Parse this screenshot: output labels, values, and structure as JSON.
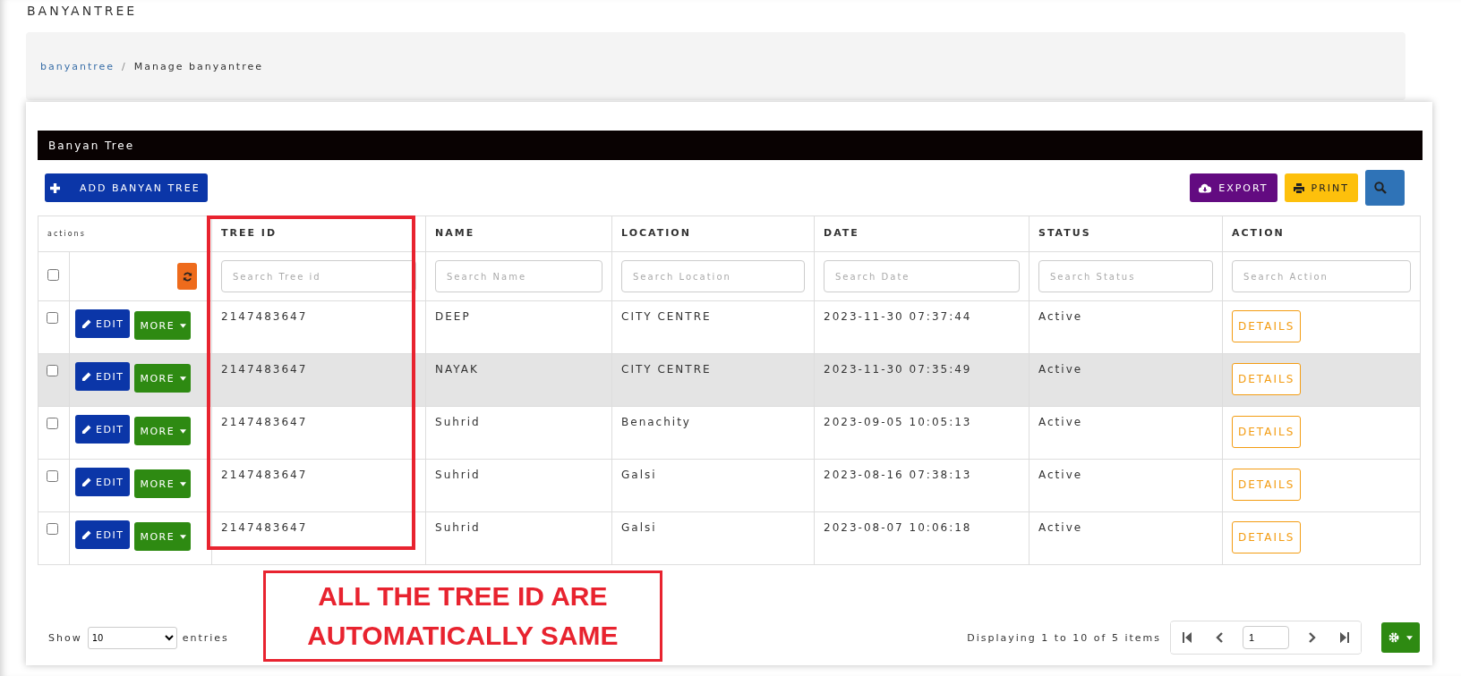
{
  "page_title": "BANYANTREE",
  "breadcrumb": {
    "link": "banyantree",
    "separator": "/",
    "current": "Manage banyantree"
  },
  "panel": {
    "title": "Banyan Tree",
    "add_button": "ADD BANYAN TREE",
    "export_button": "EXPORT",
    "print_button": "PRINT"
  },
  "table": {
    "actions_header": "actions",
    "columns": [
      "TREE ID",
      "NAME",
      "LOCATION",
      "DATE",
      "STATUS",
      "ACTION"
    ],
    "filters": [
      {
        "placeholder": "Search Tree id"
      },
      {
        "placeholder": "Search Name"
      },
      {
        "placeholder": "Search Location"
      },
      {
        "placeholder": "Search Date"
      },
      {
        "placeholder": "Search Status"
      },
      {
        "placeholder": "Search Action"
      }
    ],
    "select_all": {
      "checked": false
    },
    "rows": [
      {
        "checked": false,
        "hovered": false,
        "edit": "EDIT",
        "more": "MORE",
        "tree_id": "2147483647",
        "name": "DEEP",
        "location": "CITY CENTRE",
        "date": "2023-11-30 07:37:44",
        "status": "Active",
        "action": "DETAILS"
      },
      {
        "checked": false,
        "hovered": true,
        "edit": "EDIT",
        "more": "MORE",
        "tree_id": "2147483647",
        "name": "NAYAK",
        "location": "CITY CENTRE",
        "date": "2023-11-30 07:35:49",
        "status": "Active",
        "action": "DETAILS"
      },
      {
        "checked": false,
        "hovered": false,
        "edit": "EDIT",
        "more": "MORE",
        "tree_id": "2147483647",
        "name": "Suhrid",
        "location": "Benachity",
        "date": "2023-09-05 10:05:13",
        "status": "Active",
        "action": "DETAILS"
      },
      {
        "checked": false,
        "hovered": false,
        "edit": "EDIT",
        "more": "MORE",
        "tree_id": "2147483647",
        "name": "Suhrid",
        "location": "Galsi",
        "date": "2023-08-16 07:38:13",
        "status": "Active",
        "action": "DETAILS"
      },
      {
        "checked": false,
        "hovered": false,
        "edit": "EDIT",
        "more": "MORE",
        "tree_id": "2147483647",
        "name": "Suhrid",
        "location": "Galsi",
        "date": "2023-08-07 10:06:18",
        "status": "Active",
        "action": "DETAILS"
      }
    ]
  },
  "annotation": {
    "text": "ALL THE TREE ID ARE AUTOMATICALLY SAME"
  },
  "footer": {
    "show_label": "Show",
    "page_size": "10",
    "entries_label": "entries",
    "summary": "Displaying 1 to 10 of 5 items",
    "page": "1"
  }
}
